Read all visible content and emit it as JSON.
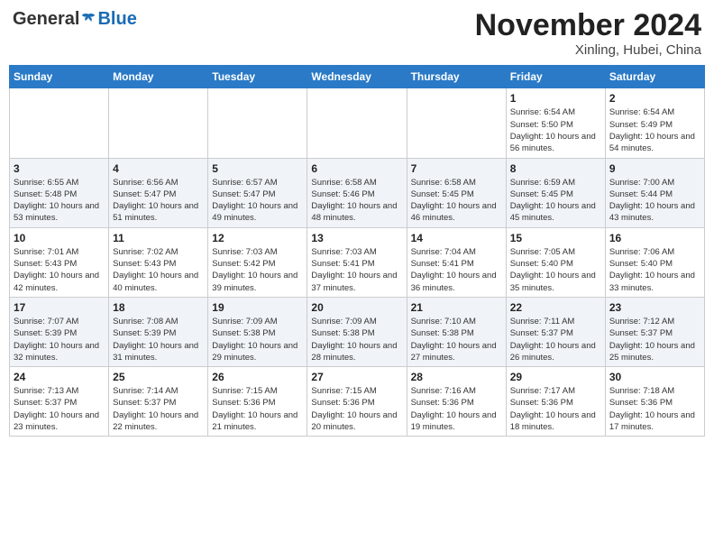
{
  "header": {
    "logo_general": "General",
    "logo_blue": "Blue",
    "month": "November 2024",
    "location": "Xinling, Hubei, China"
  },
  "weekdays": [
    "Sunday",
    "Monday",
    "Tuesday",
    "Wednesday",
    "Thursday",
    "Friday",
    "Saturday"
  ],
  "rows": [
    [
      {
        "day": "",
        "info": ""
      },
      {
        "day": "",
        "info": ""
      },
      {
        "day": "",
        "info": ""
      },
      {
        "day": "",
        "info": ""
      },
      {
        "day": "",
        "info": ""
      },
      {
        "day": "1",
        "info": "Sunrise: 6:54 AM\nSunset: 5:50 PM\nDaylight: 10 hours and 56 minutes."
      },
      {
        "day": "2",
        "info": "Sunrise: 6:54 AM\nSunset: 5:49 PM\nDaylight: 10 hours and 54 minutes."
      }
    ],
    [
      {
        "day": "3",
        "info": "Sunrise: 6:55 AM\nSunset: 5:48 PM\nDaylight: 10 hours and 53 minutes."
      },
      {
        "day": "4",
        "info": "Sunrise: 6:56 AM\nSunset: 5:47 PM\nDaylight: 10 hours and 51 minutes."
      },
      {
        "day": "5",
        "info": "Sunrise: 6:57 AM\nSunset: 5:47 PM\nDaylight: 10 hours and 49 minutes."
      },
      {
        "day": "6",
        "info": "Sunrise: 6:58 AM\nSunset: 5:46 PM\nDaylight: 10 hours and 48 minutes."
      },
      {
        "day": "7",
        "info": "Sunrise: 6:58 AM\nSunset: 5:45 PM\nDaylight: 10 hours and 46 minutes."
      },
      {
        "day": "8",
        "info": "Sunrise: 6:59 AM\nSunset: 5:45 PM\nDaylight: 10 hours and 45 minutes."
      },
      {
        "day": "9",
        "info": "Sunrise: 7:00 AM\nSunset: 5:44 PM\nDaylight: 10 hours and 43 minutes."
      }
    ],
    [
      {
        "day": "10",
        "info": "Sunrise: 7:01 AM\nSunset: 5:43 PM\nDaylight: 10 hours and 42 minutes."
      },
      {
        "day": "11",
        "info": "Sunrise: 7:02 AM\nSunset: 5:43 PM\nDaylight: 10 hours and 40 minutes."
      },
      {
        "day": "12",
        "info": "Sunrise: 7:03 AM\nSunset: 5:42 PM\nDaylight: 10 hours and 39 minutes."
      },
      {
        "day": "13",
        "info": "Sunrise: 7:03 AM\nSunset: 5:41 PM\nDaylight: 10 hours and 37 minutes."
      },
      {
        "day": "14",
        "info": "Sunrise: 7:04 AM\nSunset: 5:41 PM\nDaylight: 10 hours and 36 minutes."
      },
      {
        "day": "15",
        "info": "Sunrise: 7:05 AM\nSunset: 5:40 PM\nDaylight: 10 hours and 35 minutes."
      },
      {
        "day": "16",
        "info": "Sunrise: 7:06 AM\nSunset: 5:40 PM\nDaylight: 10 hours and 33 minutes."
      }
    ],
    [
      {
        "day": "17",
        "info": "Sunrise: 7:07 AM\nSunset: 5:39 PM\nDaylight: 10 hours and 32 minutes."
      },
      {
        "day": "18",
        "info": "Sunrise: 7:08 AM\nSunset: 5:39 PM\nDaylight: 10 hours and 31 minutes."
      },
      {
        "day": "19",
        "info": "Sunrise: 7:09 AM\nSunset: 5:38 PM\nDaylight: 10 hours and 29 minutes."
      },
      {
        "day": "20",
        "info": "Sunrise: 7:09 AM\nSunset: 5:38 PM\nDaylight: 10 hours and 28 minutes."
      },
      {
        "day": "21",
        "info": "Sunrise: 7:10 AM\nSunset: 5:38 PM\nDaylight: 10 hours and 27 minutes."
      },
      {
        "day": "22",
        "info": "Sunrise: 7:11 AM\nSunset: 5:37 PM\nDaylight: 10 hours and 26 minutes."
      },
      {
        "day": "23",
        "info": "Sunrise: 7:12 AM\nSunset: 5:37 PM\nDaylight: 10 hours and 25 minutes."
      }
    ],
    [
      {
        "day": "24",
        "info": "Sunrise: 7:13 AM\nSunset: 5:37 PM\nDaylight: 10 hours and 23 minutes."
      },
      {
        "day": "25",
        "info": "Sunrise: 7:14 AM\nSunset: 5:37 PM\nDaylight: 10 hours and 22 minutes."
      },
      {
        "day": "26",
        "info": "Sunrise: 7:15 AM\nSunset: 5:36 PM\nDaylight: 10 hours and 21 minutes."
      },
      {
        "day": "27",
        "info": "Sunrise: 7:15 AM\nSunset: 5:36 PM\nDaylight: 10 hours and 20 minutes."
      },
      {
        "day": "28",
        "info": "Sunrise: 7:16 AM\nSunset: 5:36 PM\nDaylight: 10 hours and 19 minutes."
      },
      {
        "day": "29",
        "info": "Sunrise: 7:17 AM\nSunset: 5:36 PM\nDaylight: 10 hours and 18 minutes."
      },
      {
        "day": "30",
        "info": "Sunrise: 7:18 AM\nSunset: 5:36 PM\nDaylight: 10 hours and 17 minutes."
      }
    ]
  ]
}
